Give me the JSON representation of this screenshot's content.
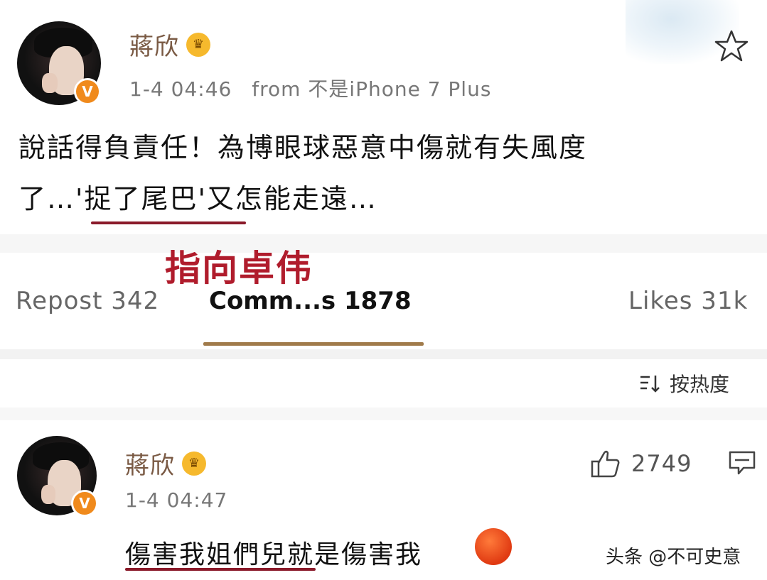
{
  "post": {
    "username": "蔣欣",
    "crown_icon": "crown-emoji-icon",
    "timestamp": "1-4 04:46",
    "source": "from 不是iPhone 7 Plus",
    "text_line1": "說話得負責任！為博眼球惡意中傷就有失風度",
    "text_line2": "了…'捉了尾巴'又怎能走遠…",
    "favorite_icon": "star-outline-icon",
    "verified_badge": "V"
  },
  "annotation": {
    "text": "指向卓伟",
    "color": "#b01c2c"
  },
  "stats": {
    "repost": "Repost 342",
    "comments": "Comm...s 1878",
    "likes": "Likes 31k"
  },
  "sort": {
    "icon": "sort-icon",
    "label": "按热度"
  },
  "comment": {
    "username": "蔣欣",
    "timestamp": "1-4 04:47",
    "text": "傷害我姐們兒就是傷害我",
    "like_icon": "thumbs-up-icon",
    "like_count": "2749",
    "reply_icon": "comment-icon",
    "verified_badge": "V",
    "emoji": "angry-face-emoji-icon"
  },
  "watermark": {
    "text": "头条 @不可史意"
  },
  "colors": {
    "username": "#7a5a44",
    "underline": "#8a1a2a",
    "tab_underline": "#a07a4a",
    "verified": "#f08a1c"
  }
}
